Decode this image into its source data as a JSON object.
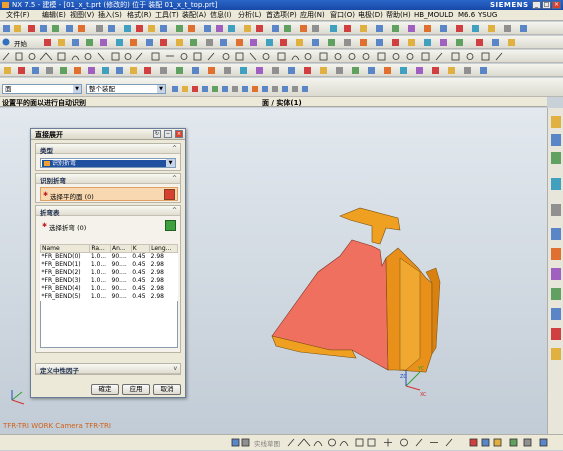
{
  "window": {
    "title": "NX 7.5 - 建模 - [01_x_t.prt (修改的) 位于 装配 01_x_t_top.prt]",
    "brand": "SIEMENS"
  },
  "menubar": {
    "items": [
      "文件(F)",
      "编辑(E)",
      "视图(V)",
      "插入(S)",
      "格式(R)",
      "工具(T)",
      "装配(A)",
      "信息(I)",
      "分析(L)",
      "首选项(P)",
      "应用(N)",
      "窗口(O)",
      "电极(D)",
      "帮助(H)",
      "HB_MOULD",
      "M6.6",
      "YSUG"
    ]
  },
  "toolbar": {
    "start_label": "开始",
    "selection_filter": "面",
    "assembly_scope": "整个装配"
  },
  "prompt": "设置平的面以进行自动识别",
  "view_label": "面 / 实体(1)",
  "wcs_label": "TFR-TRI WORK Camera TFR-TRI",
  "bottom_label": "实线草图",
  "dialog": {
    "title": "直接展开",
    "type_group": "类型",
    "type_value": "识别折弯",
    "identify_group": "识别折弯",
    "select_face_label": "选择平的面 (0)",
    "bend_table_group": "折弯表",
    "select_bend_label": "选择折弯 (0)",
    "neutral_factor_group": "定义中性因子",
    "columns": [
      "Name",
      "Ra...",
      "An...",
      "K",
      "Leng..."
    ],
    "rows": [
      [
        "*FR_BEND(0)",
        "1.0...",
        "90....",
        "0.45",
        "2.98"
      ],
      [
        "*FR_BEND(1)",
        "1.0...",
        "90....",
        "0.45",
        "2.98"
      ],
      [
        "*FR_BEND(2)",
        "1.0...",
        "90....",
        "0.45",
        "2.98"
      ],
      [
        "*FR_BEND(3)",
        "1.0...",
        "90....",
        "0.45",
        "2.98"
      ],
      [
        "*FR_BEND(4)",
        "1.0...",
        "90....",
        "0.45",
        "2.98"
      ],
      [
        "*FR_BEND(5)",
        "1.0...",
        "90....",
        "0.45",
        "2.98"
      ]
    ],
    "ok_label": "確定",
    "apply_label": "应用",
    "cancel_label": "取消"
  },
  "axes": {
    "x": "XC",
    "y": "YC",
    "z": "ZC"
  },
  "colors": {
    "face_selected": "#f07060",
    "part": "#f0a020",
    "titlebar": "#1848a8"
  }
}
